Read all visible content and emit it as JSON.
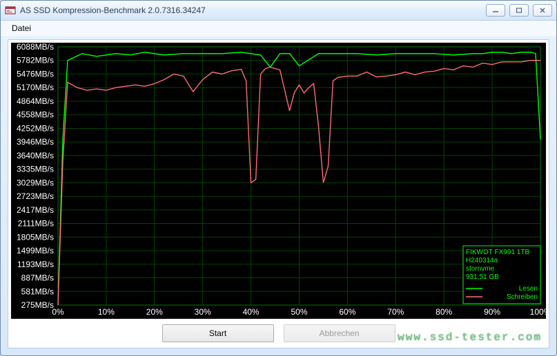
{
  "window": {
    "title": "AS SSD Kompression-Benchmark 2.0.7316.34247"
  },
  "menu": {
    "file": "Datei"
  },
  "buttons": {
    "start": "Start",
    "abort": "Abbrechen"
  },
  "legend": {
    "device": "FIKWOT FX991 1TB",
    "firmware": "H240314a",
    "driver": "stornvme",
    "capacity": "931,51 GB",
    "read": "Lesen",
    "write": "Schreiben"
  },
  "watermark": "www.ssd-tester.com",
  "chart_data": {
    "type": "line",
    "xlabel": "",
    "ylabel": "",
    "xlim": [
      0,
      100
    ],
    "ylim": [
      275,
      6088
    ],
    "y_ticks": [
      275,
      581,
      887,
      1193,
      1499,
      1805,
      2111,
      2417,
      2723,
      3029,
      3335,
      3640,
      3946,
      4252,
      4558,
      4864,
      5170,
      5476,
      5782,
      6088
    ],
    "y_tick_suffix": "MB/s",
    "x_ticks": [
      0,
      10,
      20,
      30,
      40,
      50,
      60,
      70,
      80,
      90,
      100
    ],
    "x_tick_suffix": "%",
    "series": [
      {
        "name": "Lesen",
        "color": "#00ff00",
        "x": [
          0,
          1,
          2,
          5,
          8,
          12,
          15,
          18,
          22,
          26,
          30,
          34,
          38,
          42,
          44,
          46,
          48,
          50,
          54,
          58,
          62,
          66,
          70,
          74,
          78,
          82,
          86,
          88,
          90,
          92,
          94,
          96,
          98,
          99,
          100
        ],
        "y": [
          275,
          4000,
          5782,
          5935,
          5874,
          5935,
          5904,
          5966,
          5904,
          5935,
          5935,
          5935,
          5966,
          5904,
          5630,
          5935,
          5935,
          5660,
          5935,
          5935,
          5935,
          5904,
          5935,
          5935,
          5935,
          5904,
          5935,
          5935,
          5966,
          5966,
          5935,
          5966,
          5966,
          5935,
          4000
        ]
      },
      {
        "name": "Schreiben",
        "color": "#ff6a7a",
        "x": [
          0,
          1,
          2,
          4,
          6,
          8,
          10,
          12,
          14,
          16,
          18,
          20,
          22,
          24,
          26,
          28,
          30,
          32,
          34,
          36,
          38,
          39,
          40,
          41,
          42,
          43,
          44,
          46,
          48,
          49,
          50,
          51,
          52,
          53,
          54,
          55,
          56,
          57,
          58,
          60,
          62,
          64,
          66,
          68,
          70,
          72,
          74,
          76,
          78,
          80,
          82,
          84,
          86,
          88,
          90,
          92,
          94,
          96,
          98,
          100
        ],
        "y": [
          275,
          3500,
          5290,
          5170,
          5110,
          5140,
          5110,
          5170,
          5200,
          5230,
          5200,
          5260,
          5350,
          5476,
          5430,
          5080,
          5350,
          5520,
          5476,
          5550,
          5580,
          5320,
          3029,
          3100,
          5476,
          5600,
          5630,
          5570,
          4650,
          5060,
          5230,
          5050,
          5170,
          5260,
          4300,
          3029,
          3400,
          5320,
          5400,
          5430,
          5430,
          5520,
          5410,
          5430,
          5460,
          5520,
          5460,
          5520,
          5540,
          5600,
          5570,
          5660,
          5630,
          5720,
          5690,
          5750,
          5750,
          5750,
          5782,
          5782
        ]
      }
    ]
  }
}
